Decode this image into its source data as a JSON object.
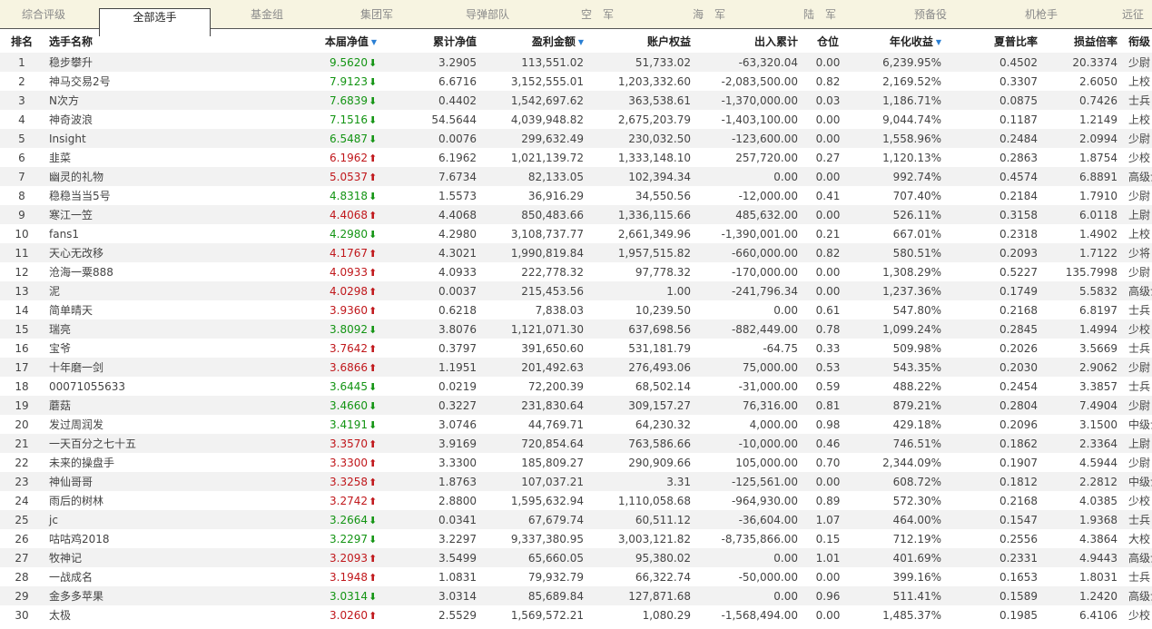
{
  "tabs": [
    "综合评级",
    "全部选手",
    "基金组",
    "集团军",
    "导弹部队",
    "空　军",
    "海　军",
    "陆　军",
    "预备役",
    "机枪手",
    "远征"
  ],
  "active_tab": 1,
  "columns": [
    "排名",
    "选手名称",
    "本届净值",
    "累计净值",
    "盈利金额",
    "账户权益",
    "出入累计",
    "仓位",
    "年化收益",
    "夏普比率",
    "损益倍率",
    "衔级"
  ],
  "sorted_columns": [
    2,
    4,
    8
  ],
  "colors": {
    "up": "#c0171b",
    "down": "#139413",
    "sort": "#2a7fd4"
  },
  "rows": [
    [
      "1",
      "稳步攀升",
      "9.5620",
      "down",
      "3.2905",
      "113,551.02",
      "51,733.02",
      "-63,320.04",
      "0.00",
      "6,239.95%",
      "0.4502",
      "20.3374",
      "少尉"
    ],
    [
      "2",
      "神马交易2号",
      "7.9123",
      "down",
      "6.6716",
      "3,152,555.01",
      "1,203,332.60",
      "-2,083,500.00",
      "0.82",
      "2,169.52%",
      "0.3307",
      "2.6050",
      "上校"
    ],
    [
      "3",
      "N次方",
      "7.6839",
      "down",
      "0.4402",
      "1,542,697.62",
      "363,538.61",
      "-1,370,000.00",
      "0.03",
      "1,186.71%",
      "0.0875",
      "0.7426",
      "士兵"
    ],
    [
      "4",
      "神奇波浪",
      "7.1516",
      "down",
      "54.5644",
      "4,039,948.82",
      "2,675,203.79",
      "-1,403,100.00",
      "0.00",
      "9,044.74%",
      "0.1187",
      "1.2149",
      "上校"
    ],
    [
      "5",
      "Insight",
      "6.5487",
      "down",
      "0.0076",
      "299,632.49",
      "230,032.50",
      "-123,600.00",
      "0.00",
      "1,558.96%",
      "0.2484",
      "2.0994",
      "少尉"
    ],
    [
      "6",
      "韭菜",
      "6.1962",
      "up",
      "6.1962",
      "1,021,139.72",
      "1,333,148.10",
      "257,720.00",
      "0.27",
      "1,120.13%",
      "0.2863",
      "1.8754",
      "少校"
    ],
    [
      "7",
      "幽灵的礼物",
      "5.0537",
      "up",
      "7.6734",
      "82,133.05",
      "102,394.34",
      "0.00",
      "0.00",
      "992.74%",
      "0.4574",
      "6.8891",
      "高级士官"
    ],
    [
      "8",
      "稳稳当当5号",
      "4.8318",
      "down",
      "1.5573",
      "36,916.29",
      "34,550.56",
      "-12,000.00",
      "0.41",
      "707.40%",
      "0.2184",
      "1.7910",
      "少尉"
    ],
    [
      "9",
      "寒江一笠",
      "4.4068",
      "up",
      "4.4068",
      "850,483.66",
      "1,336,115.66",
      "485,632.00",
      "0.00",
      "526.11%",
      "0.3158",
      "6.0118",
      "上尉"
    ],
    [
      "10",
      "fans1",
      "4.2980",
      "down",
      "4.2980",
      "3,108,737.77",
      "2,661,349.96",
      "-1,390,001.00",
      "0.21",
      "667.01%",
      "0.2318",
      "1.4902",
      "上校"
    ],
    [
      "11",
      "天心无改移",
      "4.1767",
      "up",
      "4.3021",
      "1,990,819.84",
      "1,957,515.82",
      "-660,000.00",
      "0.82",
      "580.51%",
      "0.2093",
      "1.7122",
      "少将"
    ],
    [
      "12",
      "沧海一粟888",
      "4.0933",
      "up",
      "4.0933",
      "222,778.32",
      "97,778.32",
      "-170,000.00",
      "0.00",
      "1,308.29%",
      "0.5227",
      "135.7998",
      "少尉"
    ],
    [
      "13",
      "泥",
      "4.0298",
      "up",
      "0.0037",
      "215,453.56",
      "1.00",
      "-241,796.34",
      "0.00",
      "1,237.36%",
      "0.1749",
      "5.5832",
      "高级士官"
    ],
    [
      "14",
      "简单晴天",
      "3.9360",
      "up",
      "0.6218",
      "7,838.03",
      "10,239.50",
      "0.00",
      "0.61",
      "547.80%",
      "0.2168",
      "6.8197",
      "士兵"
    ],
    [
      "15",
      "瑞亮",
      "3.8092",
      "down",
      "3.8076",
      "1,121,071.30",
      "637,698.56",
      "-882,449.00",
      "0.78",
      "1,099.24%",
      "0.2845",
      "1.4994",
      "少校"
    ],
    [
      "16",
      "宝爷",
      "3.7642",
      "up",
      "0.3797",
      "391,650.60",
      "531,181.79",
      "-64.75",
      "0.33",
      "509.98%",
      "0.2026",
      "3.5669",
      "士兵"
    ],
    [
      "17",
      "十年磨一剑",
      "3.6866",
      "up",
      "1.1951",
      "201,492.63",
      "276,493.06",
      "75,000.00",
      "0.53",
      "543.35%",
      "0.2030",
      "2.9062",
      "少尉"
    ],
    [
      "18",
      "00071055633",
      "3.6445",
      "down",
      "0.0219",
      "72,200.39",
      "68,502.14",
      "-31,000.00",
      "0.59",
      "488.22%",
      "0.2454",
      "3.3857",
      "士兵"
    ],
    [
      "19",
      "蘑菇",
      "3.4660",
      "down",
      "0.3227",
      "231,830.64",
      "309,157.27",
      "76,316.00",
      "0.81",
      "879.21%",
      "0.2804",
      "7.4904",
      "少尉"
    ],
    [
      "20",
      "发过周润发",
      "3.4191",
      "down",
      "3.0746",
      "44,769.71",
      "64,230.32",
      "4,000.00",
      "0.98",
      "429.18%",
      "0.2096",
      "3.1500",
      "中级士官"
    ],
    [
      "21",
      "一天百分之七十五",
      "3.3570",
      "up",
      "3.9169",
      "720,854.64",
      "763,586.66",
      "-10,000.00",
      "0.46",
      "746.51%",
      "0.1862",
      "2.3364",
      "上尉"
    ],
    [
      "22",
      "未来的操盘手",
      "3.3300",
      "up",
      "3.3300",
      "185,809.27",
      "290,909.66",
      "105,000.00",
      "0.70",
      "2,344.09%",
      "0.1907",
      "4.5944",
      "少尉"
    ],
    [
      "23",
      "神仙哥哥",
      "3.3258",
      "up",
      "1.8763",
      "107,037.21",
      "3.31",
      "-125,561.00",
      "0.00",
      "608.72%",
      "0.1812",
      "2.2812",
      "中级士官"
    ],
    [
      "24",
      "雨后的树林",
      "3.2742",
      "up",
      "2.8800",
      "1,595,632.94",
      "1,110,058.68",
      "-964,930.00",
      "0.89",
      "572.30%",
      "0.2168",
      "4.0385",
      "少校"
    ],
    [
      "25",
      "jc",
      "3.2664",
      "down",
      "0.0341",
      "67,679.74",
      "60,511.12",
      "-36,604.00",
      "1.07",
      "464.00%",
      "0.1547",
      "1.9368",
      "士兵"
    ],
    [
      "26",
      "咕咕鸡2018",
      "3.2297",
      "down",
      "3.2297",
      "9,337,380.95",
      "3,003,121.82",
      "-8,735,866.00",
      "0.15",
      "712.19%",
      "0.2556",
      "4.3864",
      "大校"
    ],
    [
      "27",
      "牧神记",
      "3.2093",
      "up",
      "3.5499",
      "65,660.05",
      "95,380.02",
      "0.00",
      "1.01",
      "401.69%",
      "0.2331",
      "4.9443",
      "高级士官"
    ],
    [
      "28",
      "一战成名",
      "3.1948",
      "up",
      "1.0831",
      "79,932.79",
      "66,322.74",
      "-50,000.00",
      "0.00",
      "399.16%",
      "0.1653",
      "1.8031",
      "士兵"
    ],
    [
      "29",
      "金多多苹果",
      "3.0314",
      "down",
      "3.0314",
      "85,689.84",
      "127,871.68",
      "0.00",
      "0.96",
      "511.41%",
      "0.1589",
      "1.2420",
      "高级士官"
    ],
    [
      "30",
      "太极",
      "3.0260",
      "up",
      "2.5529",
      "1,569,572.21",
      "1,080.29",
      "-1,568,494.00",
      "0.00",
      "1,485.37%",
      "0.1985",
      "6.4106",
      "少校"
    ]
  ]
}
